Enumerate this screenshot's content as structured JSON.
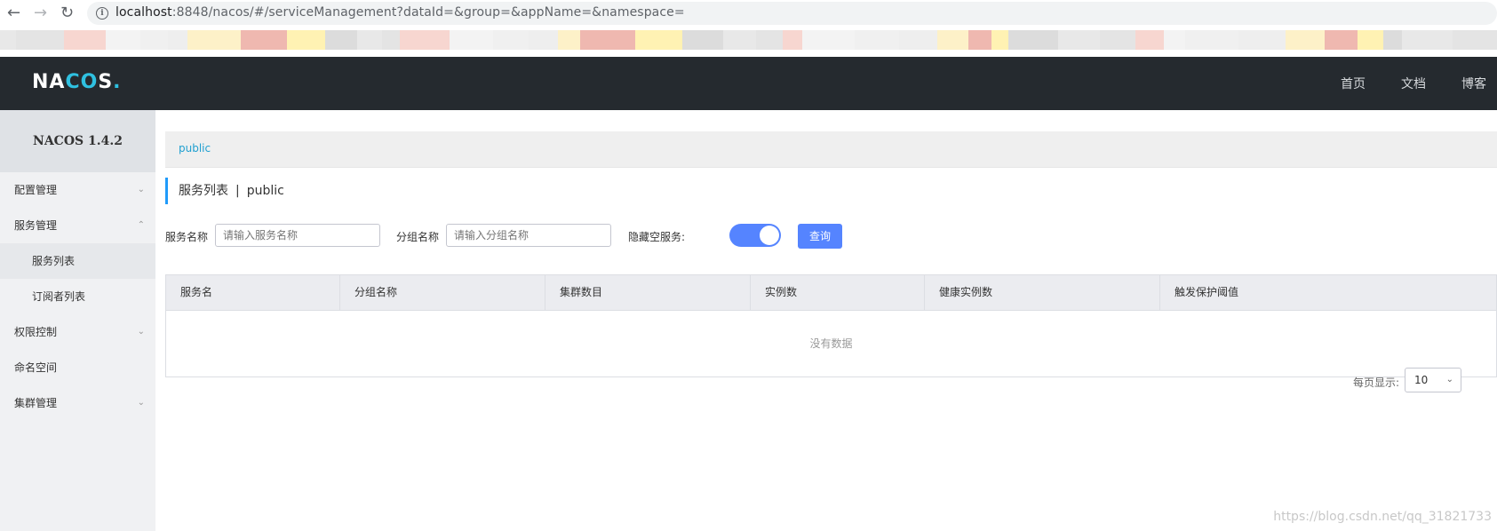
{
  "browser": {
    "url_host": "localhost",
    "url_rest": ":8848/nacos/#/serviceManagement?dataId=&group=&appName=&namespace="
  },
  "topnav": {
    "logo": "NACOS.",
    "links": [
      "首页",
      "文档",
      "博客"
    ]
  },
  "sidebar": {
    "version": "NACOS 1.4.2",
    "items": [
      {
        "label": "配置管理",
        "chevron": "chevron-down-icon"
      },
      {
        "label": "服务管理",
        "chevron": "chevron-up-icon"
      },
      {
        "label": "服务列表"
      },
      {
        "label": "订阅者列表"
      },
      {
        "label": "权限控制",
        "chevron": "chevron-down-icon"
      },
      {
        "label": "命名空间"
      },
      {
        "label": "集群管理",
        "chevron": "chevron-down-icon"
      }
    ]
  },
  "main": {
    "namespace": "public",
    "title": "服务列表",
    "title_sep": "|",
    "title_ns": "public",
    "form": {
      "service_label": "服务名称",
      "service_placeholder": "请输入服务名称",
      "group_label": "分组名称",
      "group_placeholder": "请输入分组名称",
      "hide_empty_label": "隐藏空服务:",
      "hide_empty_on": true,
      "query_button": "查询"
    },
    "table": {
      "columns": [
        "服务名",
        "分组名称",
        "集群数目",
        "实例数",
        "健康实例数",
        "触发保护阈值"
      ],
      "empty_text": "没有数据"
    },
    "pager": {
      "label": "每页显示:",
      "page_size": "10"
    }
  },
  "watermark": "https://blog.csdn.net/qq_31821733",
  "colors": {
    "accent": "#5584ff",
    "topnav_bg": "#252a2f",
    "sidebar_bg": "#f0f1f3"
  }
}
